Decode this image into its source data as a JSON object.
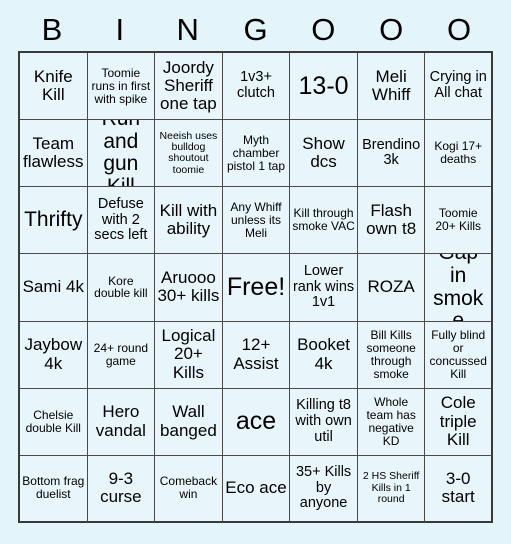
{
  "card": {
    "title": "BINGOOO",
    "background_color": "#e3f5fb",
    "cell_color": "#e8f6fb",
    "border_color": "#3a3a3a",
    "text_color": "#000000",
    "columns": 7,
    "rows": 7,
    "header_letters": [
      "B",
      "I",
      "N",
      "G",
      "O",
      "O",
      "O"
    ],
    "free_space": "Free!",
    "free_space_index": 24,
    "cells": [
      {
        "text": "Knife Kill",
        "size": "lg"
      },
      {
        "text": "Toomie runs in first with spike",
        "size": "sm"
      },
      {
        "text": "Joordy Sheriff one tap",
        "size": "lg"
      },
      {
        "text": "1v3+ clutch",
        "size": "md"
      },
      {
        "text": "13-0",
        "size": "xxl"
      },
      {
        "text": "Meli Whiff",
        "size": "lg"
      },
      {
        "text": "Crying in All chat",
        "size": "md"
      },
      {
        "text": "Team flawless",
        "size": "lg"
      },
      {
        "text": "Run and gun Kill",
        "size": "xl"
      },
      {
        "text": "Neeish uses bulldog shoutout toomie",
        "size": "xs"
      },
      {
        "text": "Myth chamber pistol 1 tap",
        "size": "sm"
      },
      {
        "text": "Show dcs",
        "size": "lg"
      },
      {
        "text": "Brendino 3k",
        "size": "md"
      },
      {
        "text": "Kogi 17+ deaths",
        "size": "sm"
      },
      {
        "text": "Thrifty",
        "size": "xl"
      },
      {
        "text": "Defuse with 2 secs left",
        "size": "md"
      },
      {
        "text": "Kill with ability",
        "size": "lg"
      },
      {
        "text": "Any Whiff unless its Meli",
        "size": "sm"
      },
      {
        "text": "Kill through smoke VAC",
        "size": "sm"
      },
      {
        "text": "Flash own t8",
        "size": "lg"
      },
      {
        "text": "Toomie 20+ Kills",
        "size": "sm"
      },
      {
        "text": "Sami 4k",
        "size": "lg"
      },
      {
        "text": "Kore double kill",
        "size": "sm"
      },
      {
        "text": "Aruooo 30+ kills",
        "size": "lg"
      },
      {
        "text": "Free!",
        "size": "xxl"
      },
      {
        "text": "Lower rank wins 1v1",
        "size": "md"
      },
      {
        "text": "ROZA",
        "size": "lg"
      },
      {
        "text": "Gap in smoke",
        "size": "xl"
      },
      {
        "text": "Jaybow 4k",
        "size": "lg"
      },
      {
        "text": "24+ round game",
        "size": "sm"
      },
      {
        "text": "Logical 20+ Kills",
        "size": "lg"
      },
      {
        "text": "12+ Assist",
        "size": "lg"
      },
      {
        "text": "Booket 4k",
        "size": "lg"
      },
      {
        "text": "Bill Kills someone through smoke",
        "size": "sm"
      },
      {
        "text": "Fully blind or concussed Kill",
        "size": "sm"
      },
      {
        "text": "Chelsie double Kill",
        "size": "sm"
      },
      {
        "text": "Hero vandal",
        "size": "lg"
      },
      {
        "text": "Wall banged",
        "size": "lg"
      },
      {
        "text": "ace",
        "size": "xxl"
      },
      {
        "text": "Killing t8 with own util",
        "size": "md"
      },
      {
        "text": "Whole team has negative KD",
        "size": "sm"
      },
      {
        "text": "Cole triple Kill",
        "size": "lg"
      },
      {
        "text": "Bottom frag duelist",
        "size": "sm"
      },
      {
        "text": "9-3 curse",
        "size": "lg"
      },
      {
        "text": "Comeback win",
        "size": "sm"
      },
      {
        "text": "Eco ace",
        "size": "lg"
      },
      {
        "text": "35+ Kills by anyone",
        "size": "md"
      },
      {
        "text": "2 HS Sheriff Kills in 1 round",
        "size": "xs"
      },
      {
        "text": "3-0 start",
        "size": "lg"
      }
    ]
  }
}
